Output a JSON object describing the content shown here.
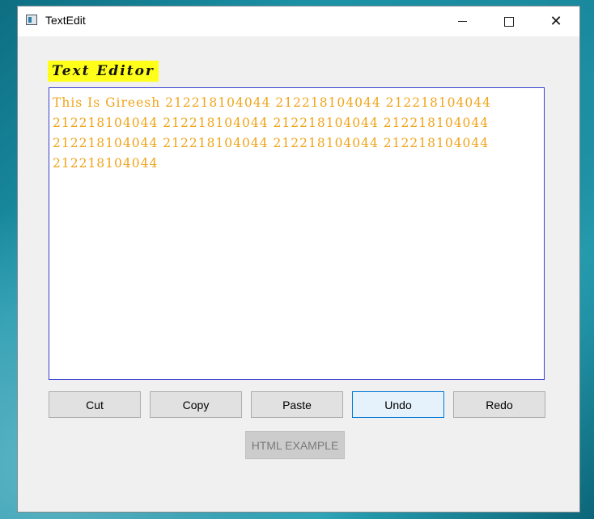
{
  "window": {
    "title": "TextEdit",
    "controls": {
      "minimize": "minimize-icon",
      "maximize": "maximize-icon",
      "close": "close-icon"
    }
  },
  "heading": {
    "label": "Text Editor",
    "background": "#ffff1a"
  },
  "editor": {
    "content": "This Is Gireesh 212218104044 212218104044 212218104044 212218104044 212218104044 212218104044 212218104044 212218104044 212218104044 212218104044 212218104044 212218104044",
    "text_color": "#f0a41a",
    "border_color": "#3a3fd0"
  },
  "buttons": {
    "cut": "Cut",
    "copy": "Copy",
    "paste": "Paste",
    "undo": "Undo",
    "redo": "Redo",
    "html_example": "HTML EXAMPLE"
  }
}
